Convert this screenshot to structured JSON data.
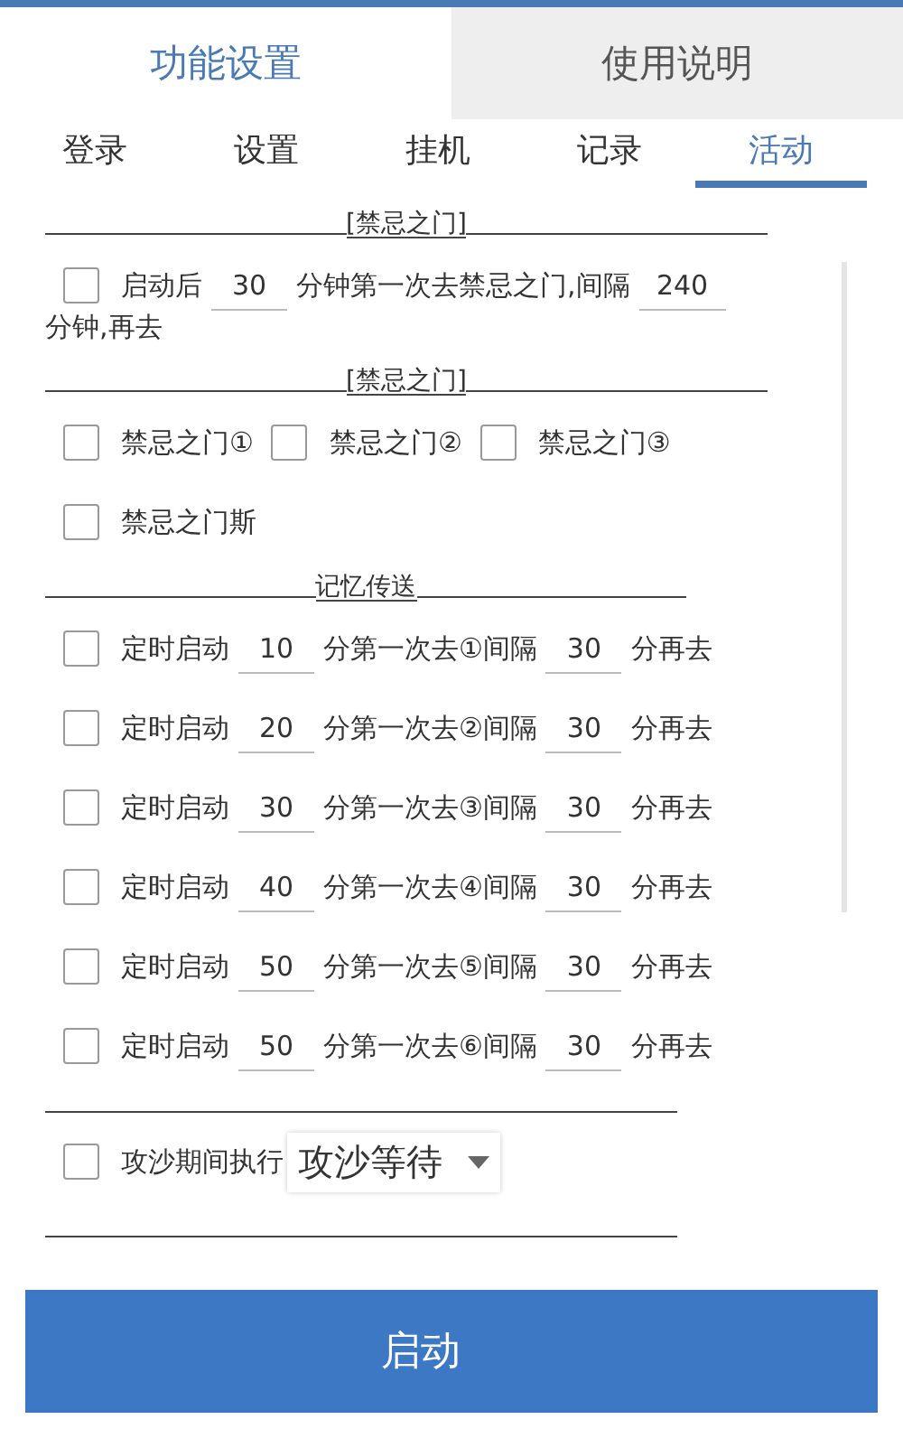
{
  "main_tabs": [
    {
      "label": "功能设置",
      "selected": true
    },
    {
      "label": "使用说明",
      "selected": false
    }
  ],
  "sub_tabs": [
    {
      "label": "登录",
      "selected": false
    },
    {
      "label": "设置",
      "selected": false
    },
    {
      "label": "挂机",
      "selected": false
    },
    {
      "label": "记录",
      "selected": false
    },
    {
      "label": "活动",
      "selected": true
    }
  ],
  "forbidden_gate_timer": {
    "header": "[禁忌之门]",
    "checked": false,
    "prefix": "启动后",
    "first_delay": "30",
    "middle": "分钟第一次去禁忌之门,间隔",
    "interval": "240",
    "suffix": "分钟,再去"
  },
  "forbidden_gates": {
    "header": "[禁忌之门]",
    "options": [
      {
        "label": "禁忌之门①",
        "checked": false
      },
      {
        "label": "禁忌之门②",
        "checked": false
      },
      {
        "label": "禁忌之门③",
        "checked": false
      },
      {
        "label": "禁忌之门斯",
        "checked": false
      }
    ]
  },
  "memory_teleport": {
    "header": "记忆传送",
    "rows": [
      {
        "checked": false,
        "label": "定时启动",
        "first_delay": "10",
        "middle": "分第一次去①间隔",
        "interval": "30",
        "suffix": "分再去"
      },
      {
        "checked": false,
        "label": "定时启动",
        "first_delay": "20",
        "middle": "分第一次去②间隔",
        "interval": "30",
        "suffix": "分再去"
      },
      {
        "checked": false,
        "label": "定时启动",
        "first_delay": "30",
        "middle": "分第一次去③间隔",
        "interval": "30",
        "suffix": "分再去"
      },
      {
        "checked": false,
        "label": "定时启动",
        "first_delay": "40",
        "middle": "分第一次去④间隔",
        "interval": "30",
        "suffix": "分再去"
      },
      {
        "checked": false,
        "label": "定时启动",
        "first_delay": "50",
        "middle": "分第一次去⑤间隔",
        "interval": "30",
        "suffix": "分再去"
      },
      {
        "checked": false,
        "label": "定时启动",
        "first_delay": "50",
        "middle": "分第一次去⑥间隔",
        "interval": "30",
        "suffix": "分再去"
      }
    ]
  },
  "siege": {
    "checked": false,
    "label": "攻沙期间执行",
    "dropdown": "攻沙等待"
  },
  "start_button": "启动"
}
